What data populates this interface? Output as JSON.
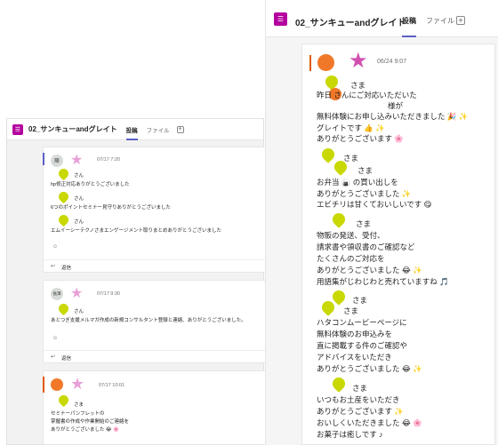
{
  "left": {
    "channel_icon": "team-icon",
    "title": "02_サンキューandグレイト",
    "tabs": [
      "投稿",
      "ファイル"
    ],
    "posts": [
      {
        "avatar_text": "陣",
        "time": "07/17 7:20",
        "lines": [
          "さん",
          "hp修正対応ありがとうございました",
          "さん",
          "6つのポイントセミナー見守りありがとうございました",
          "さん",
          "エムイーシーテクノさまエンゲージメント取りまとめありがとうございました"
        ],
        "reply_label": "返信"
      },
      {
        "avatar_text": "長澤",
        "time": "07/17 9:30",
        "lines": [
          "さん",
          "あとつぎ支援メルマガ作成の新規コンサルタント登録と連絡、ありがとうございました。"
        ],
        "reply_label": "返信"
      },
      {
        "time": "07/17 10:01",
        "lines": [
          "さま",
          "セミナーパンフレットの",
          "掌握書の作成や作業開始のご連絡を",
          "ありがとうございました 😂 🌸"
        ]
      }
    ]
  },
  "right": {
    "title": "02_サンキューandグレイト",
    "tabs": [
      "投稿",
      "ファイル"
    ],
    "time": "06/24 9:07",
    "lines": [
      "さま",
      "昨日 さんにご対応いただいた",
      "様が",
      "無料体験にお申し込みいただきました 🎉 ✨",
      "グレイトです 👍 ✨",
      "ありがとうございます 🌸",
      "さま",
      "さま",
      "お弁当 🍙 の買い出しを",
      "ありがとうございました ✨",
      "エビチリは甘くておいしいです 😋",
      "さま",
      "物販の発送、受付、",
      "請求書や領収書のご確認など",
      "たくさんのご対応を",
      "ありがとうございました 😂 ✨",
      "用語集がじわじわと売れていますね 🎵",
      "さま",
      "さま",
      "ハタコンムービーページに",
      "無料体験のお申込みを",
      "直に掲載する件のご確認や",
      "アドバイスをいただき",
      "ありがとうございました 😂 ✨",
      "さま",
      "いつもお土産をいただき",
      "ありがとうございます ✨",
      "おいしくいただきました 😂 🌸",
      "お菓子は癒しです ♪"
    ]
  },
  "colors": {
    "accent": "#5b5fc7",
    "heart": "#c8d800",
    "star": "#e8a0d8",
    "team": "#b4009e"
  }
}
